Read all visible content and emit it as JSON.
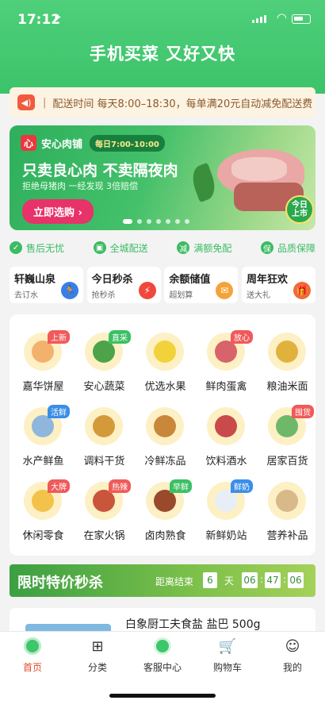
{
  "status_bar": {
    "time": "17:12",
    "location_icon": "➤",
    "wifi_icon": "wifi-icon"
  },
  "app_title": "手机买菜 又好又快",
  "notice": {
    "icon": "speaker-icon",
    "separator": "|",
    "text": "配送时间 每天8:00–18:30，每单满20元自动减免配送费"
  },
  "banner": {
    "logo_char": "心",
    "shop_name": "安心肉铺",
    "hours": "每日7:00-10:00",
    "headline": "只卖良心肉 不卖隔夜肉",
    "subtext": "拒绝母猪肉 一经发现 3倍赔偿",
    "cta": "立即选购",
    "badge_line1": "今日",
    "badge_line2": "上市",
    "slide_count": 7,
    "active_slide": 0
  },
  "features": [
    {
      "icon": "✓",
      "label": "售后无忧"
    },
    {
      "icon": "▣",
      "label": "全城配送"
    },
    {
      "icon": "减",
      "label": "满额免配"
    },
    {
      "icon": "保",
      "label": "品质保障"
    }
  ],
  "promos": [
    {
      "title": "轩巍山泉",
      "sub": "去订水",
      "color": "#3a7ee8",
      "icon": "🏃"
    },
    {
      "title": "今日秒杀",
      "sub": "抢秒杀",
      "color": "#f0483c",
      "icon": "⚡"
    },
    {
      "title": "余额储值",
      "sub": "超划算",
      "color": "#f4a33a",
      "icon": "✉"
    },
    {
      "title": "周年狂欢",
      "sub": "送大礼",
      "color": "#f26a3a",
      "icon": "🎁"
    }
  ],
  "categories": [
    {
      "label": "嘉华饼屋",
      "tag": "上新",
      "tag_color": "#f05a5a",
      "color": "#f3b16e"
    },
    {
      "label": "安心蔬菜",
      "tag": "直采",
      "tag_color": "#3cbf63",
      "color": "#4ca34a"
    },
    {
      "label": "优选水果",
      "tag": "",
      "tag_color": "",
      "color": "#f2d23a"
    },
    {
      "label": "鲜肉蛋禽",
      "tag": "放心",
      "tag_color": "#f05a5a",
      "color": "#d8636a"
    },
    {
      "label": "粮油米面",
      "tag": "",
      "tag_color": "",
      "color": "#e0b23c"
    },
    {
      "label": "水产鲜鱼",
      "tag": "活鲜",
      "tag_color": "#3a8ee8",
      "color": "#8fb6dc"
    },
    {
      "label": "调料干货",
      "tag": "",
      "tag_color": "",
      "color": "#d49a3a"
    },
    {
      "label": "冷鲜冻品",
      "tag": "",
      "tag_color": "",
      "color": "#c9873a"
    },
    {
      "label": "饮料酒水",
      "tag": "",
      "tag_color": "",
      "color": "#c94a4a"
    },
    {
      "label": "居家百货",
      "tag": "囤货",
      "tag_color": "#f05a5a",
      "color": "#6fb86a"
    },
    {
      "label": "休闲零食",
      "tag": "大牌",
      "tag_color": "#f05a5a",
      "color": "#f3c24a"
    },
    {
      "label": "在家火锅",
      "tag": "热辣",
      "tag_color": "#f05a5a",
      "color": "#c9563a"
    },
    {
      "label": "卤肉熟食",
      "tag": "早鲜",
      "tag_color": "#3cbf63",
      "color": "#9a4a2a"
    },
    {
      "label": "新鲜奶站",
      "tag": "鲜奶",
      "tag_color": "#3a8ee8",
      "color": "#e8eef6"
    },
    {
      "label": "营养补品",
      "tag": "",
      "tag_color": "",
      "color": "#d8b98a"
    }
  ],
  "flash_sale": {
    "title": "限时特价秒杀",
    "countdown_label": "距离结束",
    "days": "6",
    "day_unit": "天",
    "hours": "06",
    "minutes": "47",
    "seconds": "06"
  },
  "product_preview": {
    "name": "白象厨工夫食盐 盐巴 500g"
  },
  "tabbar": [
    {
      "label": "首页",
      "icon": "home-icon",
      "active": true
    },
    {
      "label": "分类",
      "icon": "grid-icon",
      "active": false
    },
    {
      "label": "客服中心",
      "icon": "service-icon",
      "active": false
    },
    {
      "label": "购物车",
      "icon": "cart-icon",
      "active": false
    },
    {
      "label": "我的",
      "icon": "user-icon",
      "active": false
    }
  ]
}
